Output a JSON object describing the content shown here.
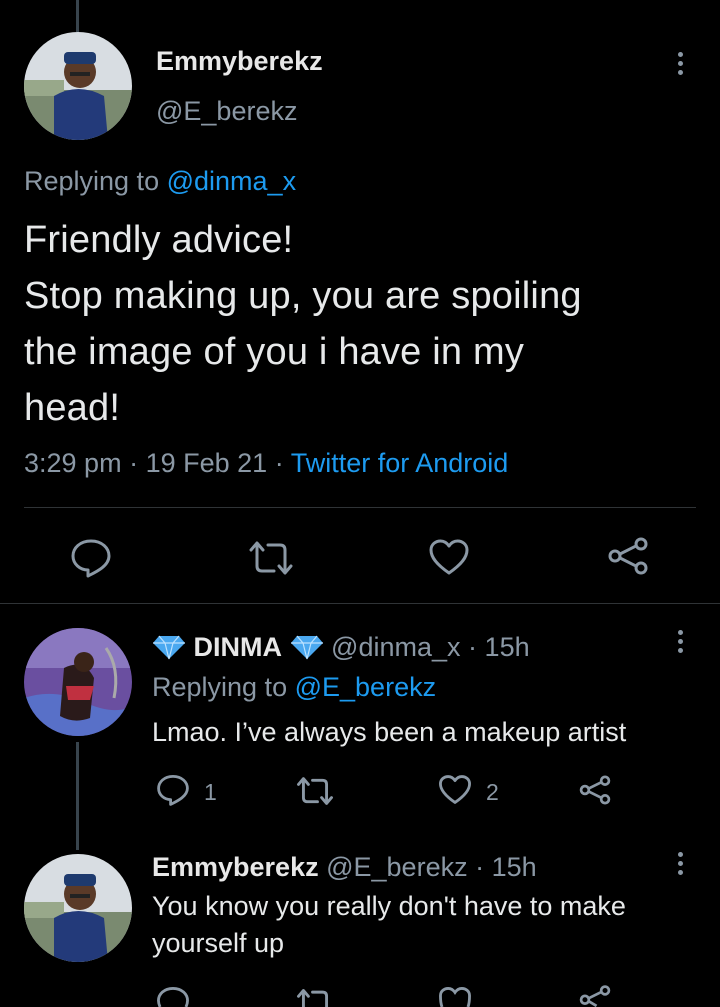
{
  "main_tweet": {
    "display_name": "Emmyberekz",
    "handle": "@E_berekz",
    "replying_prefix": "Replying to",
    "replying_to": "@dinma_x",
    "text_lines": [
      "Friendly advice!",
      "Stop making up, you are spoiling",
      "the image of you i have in my",
      "head!"
    ],
    "time": "3:29 pm",
    "date": "19 Feb 21",
    "source": "Twitter for Android",
    "sep": "·"
  },
  "reply1": {
    "display_name": "DINMA",
    "handle": "@dinma_x",
    "age": "15h",
    "replying_prefix": "Replying to",
    "replying_to": "@E_berekz",
    "text": "Lmao. I’ve always been a makeup artist",
    "reply_count": "1",
    "like_count": "2",
    "sep": "·"
  },
  "reply2": {
    "display_name": "Emmyberekz",
    "handle": "@E_berekz",
    "age": "15h",
    "text_line1": "You know you really don't have to make",
    "text_line2": "yourself up",
    "sep": "·"
  },
  "icons": {
    "reply": "comment-bubble-icon",
    "retweet": "retweet-icon",
    "like": "heart-icon",
    "share": "share-icon",
    "more": "vertical-ellipsis-icon",
    "verified_decoration": "blue-diamond-icon"
  },
  "colors": {
    "background": "#000000",
    "link": "#1d9bf0",
    "secondary": "#8b98a5",
    "text": "#e7e9ea",
    "diamond": "#4aa8f0"
  }
}
